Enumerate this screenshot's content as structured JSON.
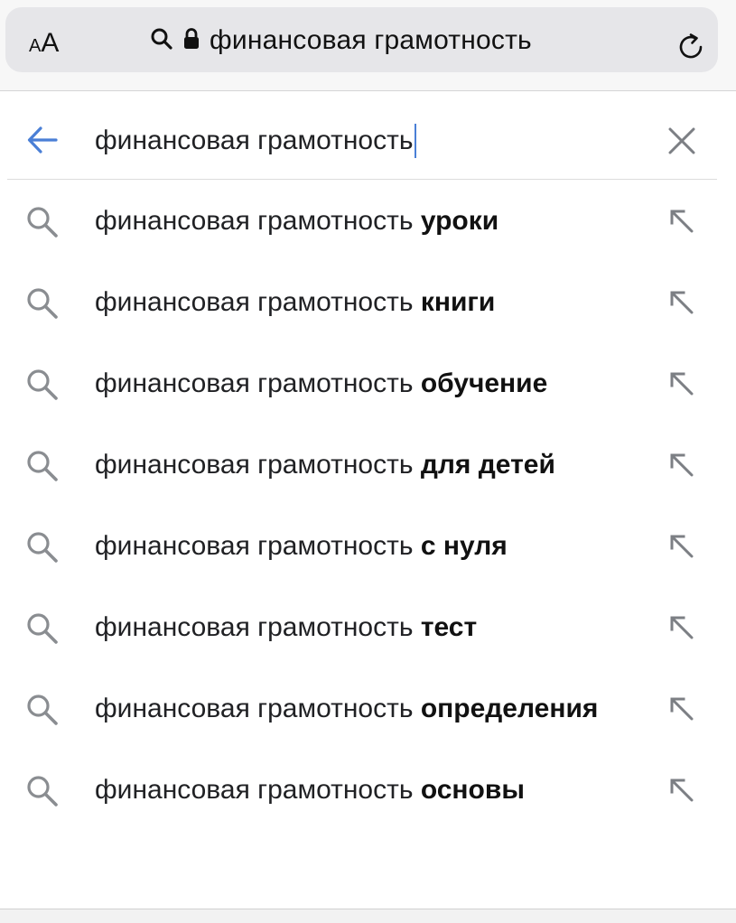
{
  "browser": {
    "text_size_small": "A",
    "text_size_big": "A",
    "url_text": "финансовая грамотность"
  },
  "search": {
    "query": "финансовая грамотность"
  },
  "suggestions": [
    {
      "prefix": "финансовая грамотность ",
      "completion": "уроки"
    },
    {
      "prefix": "финансовая грамотность ",
      "completion": "книги"
    },
    {
      "prefix": "финансовая грамотность ",
      "completion": "обучение"
    },
    {
      "prefix": "финансовая грамотность ",
      "completion": "для детей"
    },
    {
      "prefix": "финансовая грамотность ",
      "completion": "с нуля"
    },
    {
      "prefix": "финансовая грамотность ",
      "completion": "тест"
    },
    {
      "prefix": "финансовая грамотность ",
      "completion": "определения"
    },
    {
      "prefix": "финансовая грамотность ",
      "completion": "основы"
    }
  ],
  "icons": {
    "text-size": "aa-icon",
    "search": "search-icon",
    "lock": "lock-icon",
    "reload": "reload-icon",
    "back": "back-arrow-icon",
    "clear": "close-icon",
    "suggestion": "search-icon",
    "fill": "arrow-up-left-icon"
  },
  "colors": {
    "back_arrow": "#4a7fd6",
    "caret": "#4a7fd6",
    "icon_gray": "#8a8d91"
  }
}
